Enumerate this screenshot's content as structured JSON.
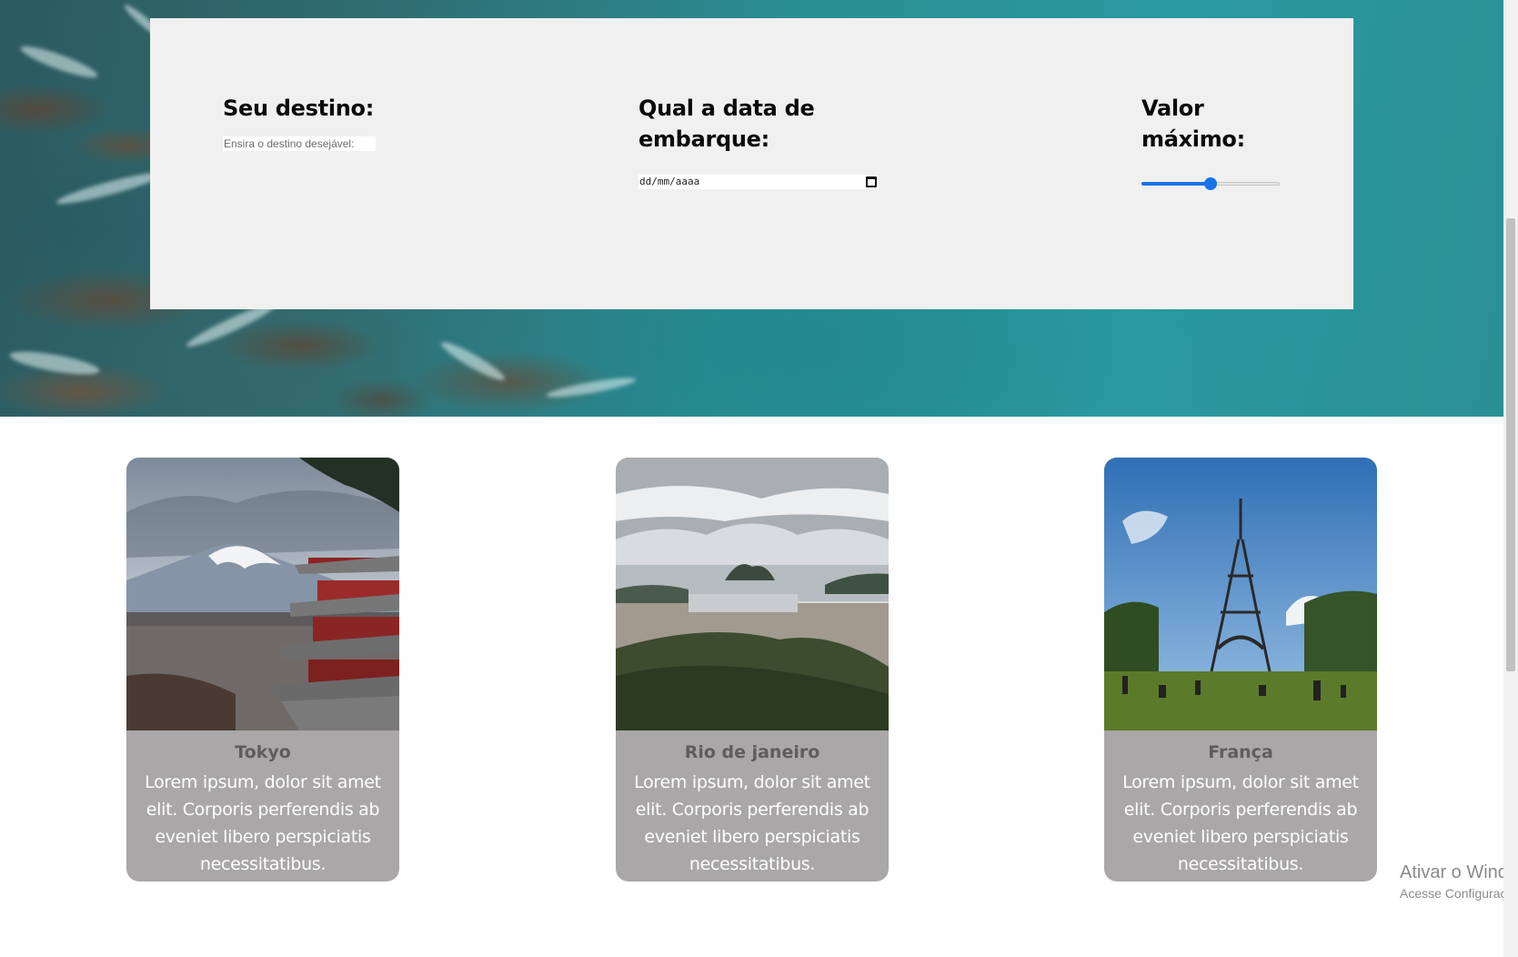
{
  "search": {
    "destination": {
      "label": "Seu destino:",
      "placeholder": "Ensira o destino desejável:"
    },
    "date": {
      "label_line1": "Qual a data de",
      "label_line2": "embarque:",
      "placeholder": "dd/mm/aaaa"
    },
    "price": {
      "label_line1": "Valor",
      "label_line2": "máximo:",
      "value_fraction": 0.5
    }
  },
  "cards": [
    {
      "title": "Tokyo",
      "text": "Lorem ipsum, dolor sit amet elit. Corporis perferendis ab eveniet libero perspiciatis necessitatibus.",
      "image": "mount-fuji-pagoda"
    },
    {
      "title": "Rio de janeiro",
      "text": "Lorem ipsum, dolor sit amet elit. Corporis perferendis ab eveniet libero perspiciatis necessitatibus.",
      "image": "rio-sugarloaf"
    },
    {
      "title": "França",
      "text": "Lorem ipsum, dolor sit amet elit. Corporis perferendis ab eveniet libero perspiciatis necessitatibus.",
      "image": "eiffel-tower"
    }
  ],
  "watermark": {
    "line1": "Ativar o Windo",
    "line2": "Acesse Configuraçõ"
  },
  "colors": {
    "panel": "#f0f0f0",
    "card": "#a9a7a7",
    "accent": "#1a73e8",
    "ocean": "#2a8d93"
  }
}
